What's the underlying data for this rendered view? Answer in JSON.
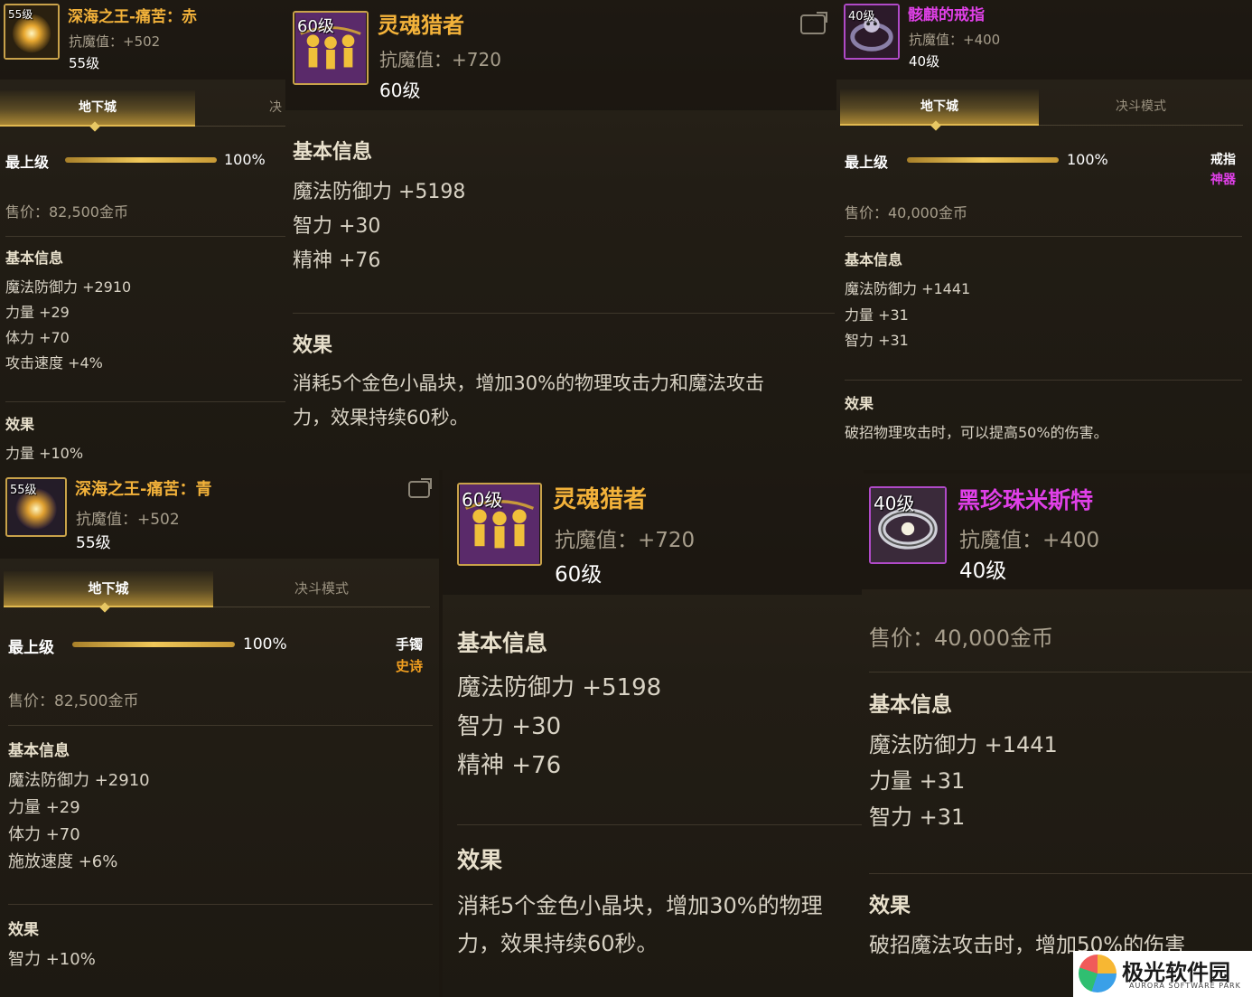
{
  "panels": {
    "p1": {
      "badge": "55级",
      "name": "深海之王-痛苦：赤",
      "resist": "抗魔值：+502",
      "level": "55级",
      "tab_active": "地下城",
      "tab_inactive": "决",
      "grade_label": "最上级",
      "grade_pct": "100%",
      "grade_fill": 1.0,
      "price": "售价：82,500金币",
      "basic_title": "基本信息",
      "stats": [
        "魔法防御力 +2910",
        "力量 +29",
        "体力 +70",
        "攻击速度 +4%"
      ],
      "effect_title": "效果",
      "effect": "力量 +10%"
    },
    "p2": {
      "badge": "60级",
      "name": "灵魂猎者",
      "resist": "抗魔值：+720",
      "level": "60级",
      "basic_title": "基本信息",
      "stats": [
        "魔法防御力 +5198",
        "智力 +30",
        "精神 +76"
      ],
      "effect_title": "效果",
      "effect_lines": [
        "消耗5个金色小晶块，增加30%的物理攻击力和魔法攻击",
        "力，效果持续60秒。"
      ]
    },
    "p3": {
      "badge": "40级",
      "name": "骸麒的戒指",
      "resist": "抗魔值：+400",
      "level": "40级",
      "tab_active": "地下城",
      "tab_inactive": "决斗模式",
      "grade_label": "最上级",
      "grade_pct": "100%",
      "grade_fill": 1.0,
      "slot": "戒指",
      "rarity": "神器",
      "price": "售价：40,000金币",
      "basic_title": "基本信息",
      "stats": [
        "魔法防御力 +1441",
        "力量 +31",
        "智力 +31"
      ],
      "effect_title": "效果",
      "effect": "破招物理攻击时，可以提高50%的伤害。"
    },
    "p4": {
      "badge": "55级",
      "name": "深海之王-痛苦：青",
      "resist": "抗魔值：+502",
      "level": "55级",
      "tab_active": "地下城",
      "tab_inactive": "决斗模式",
      "grade_label": "最上级",
      "grade_pct": "100%",
      "grade_fill": 1.0,
      "slot": "手镯",
      "rarity": "史诗",
      "price": "售价：82,500金币",
      "basic_title": "基本信息",
      "stats": [
        "魔法防御力 +2910",
        "力量 +29",
        "体力 +70",
        "施放速度 +6%"
      ],
      "effect_title": "效果",
      "effect": "智力 +10%"
    },
    "p5": {
      "badge": "60级",
      "name": "灵魂猎者",
      "resist": "抗魔值：+720",
      "level": "60级",
      "basic_title": "基本信息",
      "stats": [
        "魔法防御力 +5198",
        "智力 +30",
        "精神 +76"
      ],
      "effect_title": "效果",
      "effect_lines": [
        "消耗5个金色小晶块，增加30%的物理",
        "力，效果持续60秒。"
      ]
    },
    "p6": {
      "badge": "40级",
      "name": "黑珍珠米斯特",
      "resist": "抗魔值：+400",
      "level": "40级",
      "price": "售价：40,000金币",
      "basic_title": "基本信息",
      "stats": [
        "魔法防御力 +1441",
        "力量 +31",
        "智力 +31"
      ],
      "effect_title": "效果",
      "effect": "破招魔法攻击时，增加50%的伤害"
    }
  },
  "colors": {
    "epic_name": "#f3b23a",
    "artifact_name": "#e040e8",
    "epic_rarity": "#f3a020",
    "artifact_rarity": "#e040e8"
  },
  "watermark": {
    "cn": "极光软件园",
    "en": "AURORA SOFTWARE PARK"
  }
}
